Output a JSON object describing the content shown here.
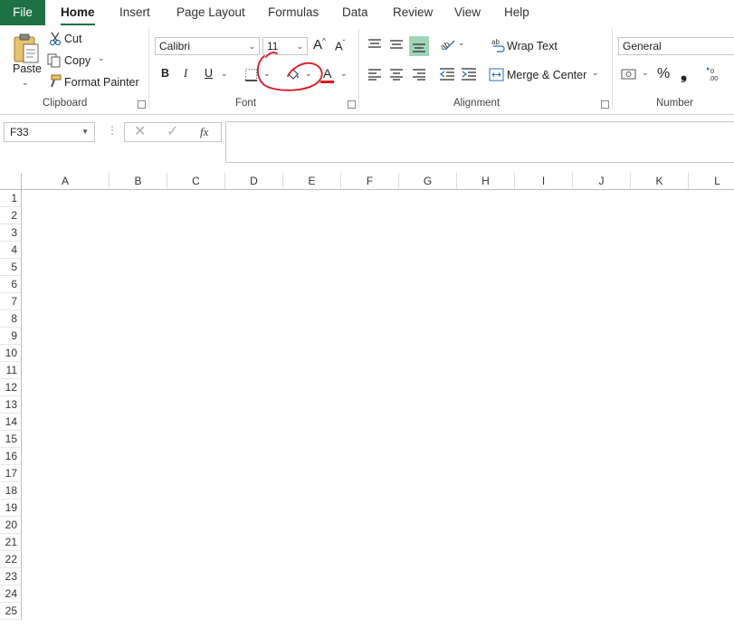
{
  "menu": {
    "file": "File",
    "tabs": [
      "Home",
      "Insert",
      "Page Layout",
      "Formulas",
      "Data",
      "Review",
      "View",
      "Help"
    ]
  },
  "clipboard": {
    "paste": "Paste",
    "cut": "Cut",
    "copy": "Copy",
    "format_painter": "Format Painter",
    "label": "Clipboard"
  },
  "font": {
    "name": "Calibri",
    "size": "11",
    "bold": "B",
    "italic": "I",
    "underline": "U",
    "font_color_glyph": "A",
    "label": "Font",
    "annotation_color": "#e0141e",
    "font_color_bar": "#e0141e"
  },
  "alignment": {
    "wrap_text": "Wrap Text",
    "merge_center": "Merge & Center",
    "label": "Alignment"
  },
  "number": {
    "format": "General",
    "percent": "%",
    "comma": "❟",
    "label": "Number"
  },
  "formula_bar": {
    "name_box": "F33",
    "fx": "fx",
    "value": ""
  },
  "sheet": {
    "columns": [
      "A",
      "B",
      "C",
      "D",
      "E",
      "F",
      "G",
      "H",
      "I",
      "J",
      "K",
      "L"
    ],
    "rows": [
      "1",
      "2",
      "3",
      "4",
      "5",
      "6",
      "7",
      "8",
      "9",
      "10",
      "11",
      "12",
      "13",
      "14",
      "15",
      "16",
      "17",
      "18",
      "19",
      "20",
      "21",
      "22",
      "23",
      "24",
      "25"
    ]
  },
  "colors": {
    "accent": "#1e7145",
    "highlight_button": "#9fd5b7"
  }
}
